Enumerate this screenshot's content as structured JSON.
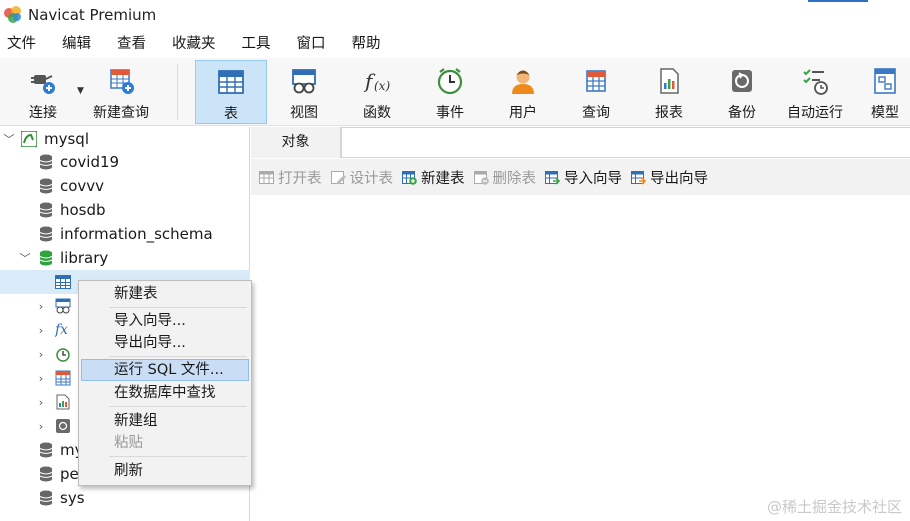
{
  "window": {
    "title": "Navicat Premium"
  },
  "menubar": [
    "文件",
    "编辑",
    "查看",
    "收藏夹",
    "工具",
    "窗口",
    "帮助"
  ],
  "toolbar": {
    "connect": "连接",
    "new_query": "新建查询",
    "table": "表",
    "view": "视图",
    "function": "函数",
    "event": "事件",
    "user": "用户",
    "query": "查询",
    "report": "报表",
    "backup": "备份",
    "automation": "自动运行",
    "model": "模型"
  },
  "navigator": {
    "connection": "mysql",
    "databases": [
      "covid19",
      "covvv",
      "hosdb",
      "information_schema",
      "library"
    ],
    "partial_items": [
      "my",
      "pe"
    ],
    "last_db": "sys"
  },
  "tabs": {
    "objects": "对象"
  },
  "object_toolbar": {
    "open_table": "打开表",
    "design_table": "设计表",
    "new_table": "新建表",
    "delete_table": "删除表",
    "import_wizard": "导入向导",
    "export_wizard": "导出向导"
  },
  "context_menu": {
    "new_table": "新建表",
    "import_wizard": "导入向导...",
    "export_wizard": "导出向导...",
    "run_sql_file": "运行 SQL 文件...",
    "find_in_db": "在数据库中查找",
    "new_group": "新建组",
    "paste": "粘贴",
    "refresh": "刷新"
  },
  "watermark": "@稀土掘金技术社区",
  "colors": {
    "accent": "#2f6fc7",
    "active_tool_bg": "#cce4f7",
    "selection_bg": "#d9ebf9",
    "menu_highlight": "#c9def5"
  }
}
